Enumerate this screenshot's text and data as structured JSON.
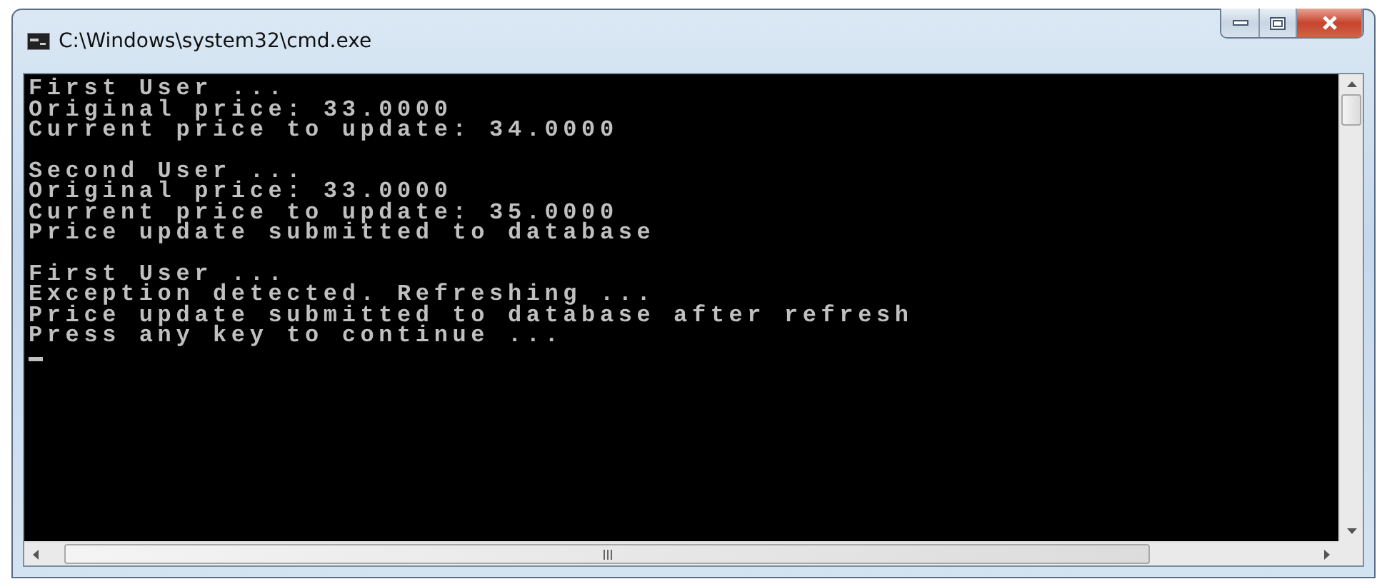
{
  "window": {
    "title": "C:\\Windows\\system32\\cmd.exe"
  },
  "console": {
    "blocks": [
      [
        "First User ...",
        "Original price: 33.0000",
        "Current price to update: 34.0000"
      ],
      [
        "Second User ...",
        "Original price: 33.0000",
        "Current price to update: 35.0000",
        "Price update submitted to database"
      ],
      [
        "First User ...",
        "Exception detected. Refreshing ...",
        "Price update submitted to database after refresh",
        "Press any key to continue ..."
      ]
    ],
    "cursor": true
  }
}
